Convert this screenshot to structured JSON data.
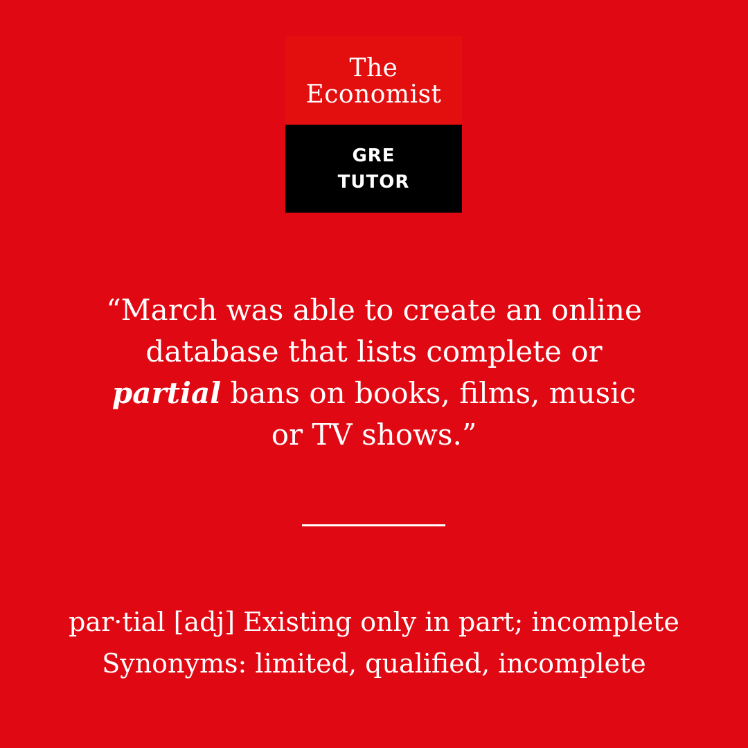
{
  "brand": {
    "the": "The",
    "name": "Economist",
    "sub_line1": "GRE",
    "sub_line2": "TUTOR"
  },
  "quote": {
    "line1": "“March was able to create an online",
    "line2": "database that lists complete or",
    "keyword": "partial",
    "line3_rest": " bans on books, films, music",
    "line4": "or TV shows.”"
  },
  "definition": {
    "line1": "par·tial [adj] Existing only in part; incomplete",
    "line2": "Synonyms: limited, qualified, incomplete"
  },
  "colors": {
    "background": "#e00812",
    "logo_red": "#e30f0f",
    "logo_black": "#000000",
    "text": "#ffffff"
  }
}
